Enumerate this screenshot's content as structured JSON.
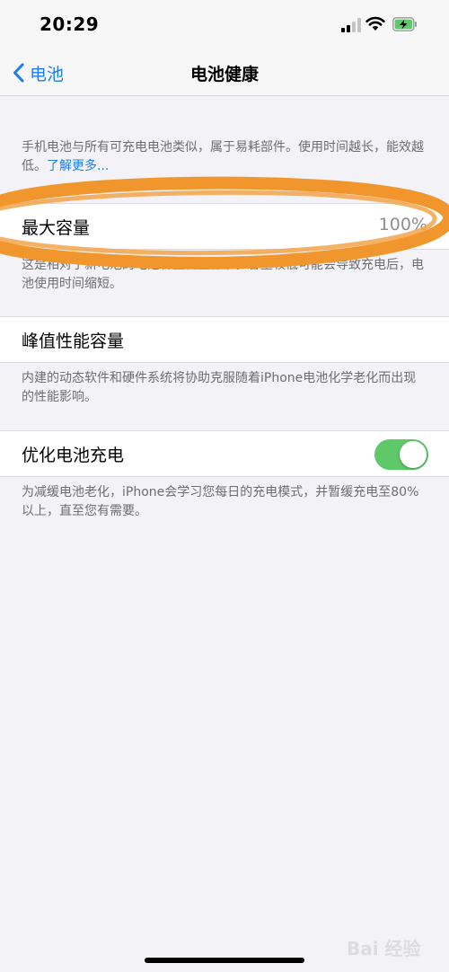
{
  "status_bar": {
    "time": "20:29"
  },
  "nav": {
    "back_label": "电池",
    "title": "电池健康"
  },
  "intro_text": "手机电池与所有可充电电池类似，属于易耗部件。使用时间越长，能效越低。",
  "intro_link": "了解更多...",
  "max_capacity": {
    "label": "最大容量",
    "value": "100%",
    "note": "这是相对于新电池的电池容量衡量标准。容量较低可能会导致充电后，电池使用时间缩短。"
  },
  "peak_performance": {
    "label": "峰值性能容量",
    "note": "内建的动态软件和硬件系统将协助克服随着iPhone电池化学老化而出现的性能影响。"
  },
  "optimized_charging": {
    "label": "优化电池充电",
    "enabled": true,
    "note": "为减缓电池老化，iPhone会学习您每日的充电模式，并暂缓充电至80%以上，直至您有需要。"
  },
  "watermark": "Bai 经验",
  "colors": {
    "accent": "#1e7cf0",
    "toggle_on": "#5fc969",
    "annotation": "#f0962c"
  }
}
